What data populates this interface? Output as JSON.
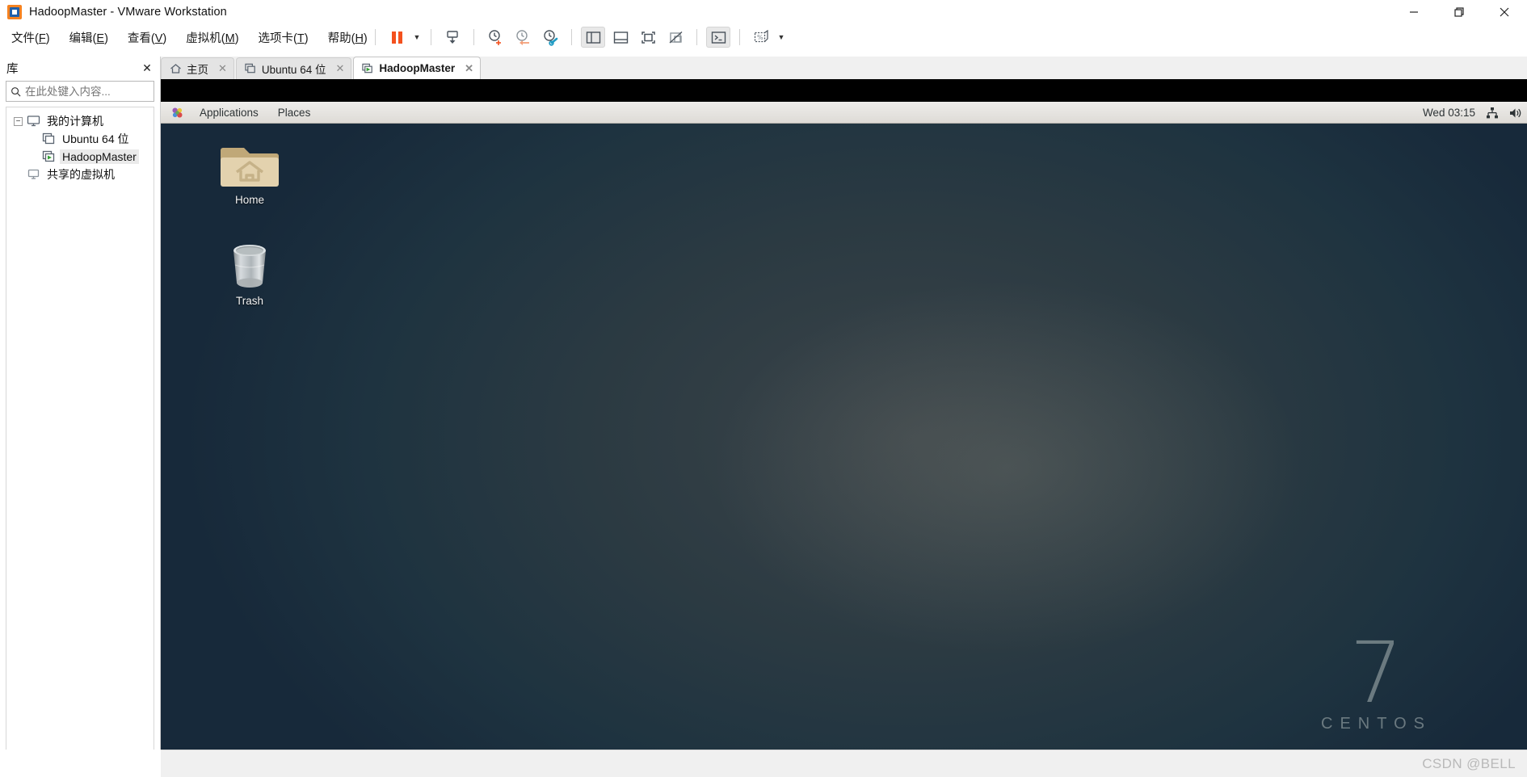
{
  "window": {
    "title": "HadoopMaster - VMware Workstation",
    "app_logo": "vmware-logo-icon",
    "controls": {
      "minimize": "minimize-icon",
      "restore": "restore-icon",
      "close": "close-icon"
    }
  },
  "menubar": {
    "items": [
      {
        "label": "文件(F)",
        "text": "文件(",
        "mnemonic": "F",
        "tail": ")"
      },
      {
        "label": "编辑(E)",
        "text": "编辑(",
        "mnemonic": "E",
        "tail": ")"
      },
      {
        "label": "查看(V)",
        "text": "查看(",
        "mnemonic": "V",
        "tail": ")"
      },
      {
        "label": "虚拟机(M)",
        "text": "虚拟机(",
        "mnemonic": "M",
        "tail": ")"
      },
      {
        "label": "选项卡(T)",
        "text": "选项卡(",
        "mnemonic": "T",
        "tail": ")"
      },
      {
        "label": "帮助(H)",
        "text": "帮助(",
        "mnemonic": "H",
        "tail": ")"
      }
    ]
  },
  "toolbar": {
    "buttons": [
      {
        "name": "suspend-button",
        "icon": "pause-icon"
      },
      {
        "name": "power-dropdown",
        "icon": "caret-down-icon"
      },
      {
        "name": "send-ctrl-alt-del-button",
        "icon": "send-keys-icon"
      },
      {
        "name": "take-snapshot-button",
        "icon": "snapshot-add-icon"
      },
      {
        "name": "revert-snapshot-button",
        "icon": "snapshot-revert-icon"
      },
      {
        "name": "snapshot-manager-button",
        "icon": "snapshot-manager-icon"
      },
      {
        "name": "show-library-button",
        "icon": "library-pane-icon"
      },
      {
        "name": "show-thumbnail-bar-button",
        "icon": "thumbnail-bar-icon"
      },
      {
        "name": "fullscreen-button",
        "icon": "fullscreen-icon"
      },
      {
        "name": "unity-mode-button",
        "icon": "unity-mode-icon"
      },
      {
        "name": "console-button",
        "icon": "console-prompt-icon"
      },
      {
        "name": "display-settings-button",
        "icon": "display-stretch-icon"
      },
      {
        "name": "display-settings-dropdown",
        "icon": "caret-down-icon"
      }
    ]
  },
  "library": {
    "title": "库",
    "close_label": "✕",
    "search": {
      "placeholder": "在此处键入内容...",
      "value": "",
      "icon": "search-icon",
      "dropdown_icon": "caret-down-icon"
    },
    "tree": [
      {
        "label": "我的计算机",
        "level": 0,
        "icon": "computer-icon",
        "expander": "−",
        "selected": false
      },
      {
        "label": "Ubuntu 64 位",
        "level": 1,
        "icon": "vm-icon",
        "selected": false
      },
      {
        "label": "HadoopMaster",
        "level": 1,
        "icon": "vm-running-icon",
        "selected": true
      },
      {
        "label": "共享的虚拟机",
        "level": 0,
        "icon": "shared-vms-icon",
        "selected": false
      }
    ]
  },
  "tabs": [
    {
      "label": "主页",
      "icon": "home-icon",
      "active": false,
      "close_label": "✕"
    },
    {
      "label": "Ubuntu 64 位",
      "icon": "vm-icon",
      "active": false,
      "close_label": "✕"
    },
    {
      "label": "HadoopMaster",
      "icon": "vm-running-icon",
      "active": true,
      "close_label": "✕"
    }
  ],
  "guest": {
    "panel": {
      "menu_icon": "gnome-foot-icon",
      "items": [
        {
          "label": "Applications",
          "name": "applications-menu"
        },
        {
          "label": "Places",
          "name": "places-menu"
        }
      ],
      "clock": "Wed 03:15",
      "tray": [
        {
          "name": "network-icon"
        },
        {
          "name": "volume-icon"
        }
      ]
    },
    "desktop_icons": [
      {
        "label": "Home",
        "icon": "home-folder-icon"
      },
      {
        "label": "Trash",
        "icon": "trash-can-icon"
      }
    ],
    "branding": {
      "version": "7",
      "name": "CENTOS"
    }
  },
  "statusbar": {
    "watermark": "CSDN @BELL"
  },
  "colors": {
    "accent_orange": "#f4511e",
    "vm_running_green": "#35a035",
    "desktop_dark": "#22333d",
    "panel_gray": "#e6e3de"
  }
}
